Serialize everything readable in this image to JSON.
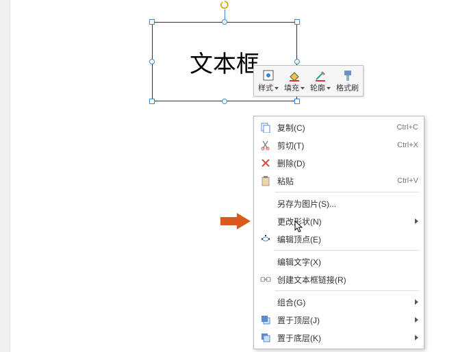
{
  "textbox": {
    "text": "文本框"
  },
  "toolbar": {
    "style": "样式",
    "fill": "填充",
    "outline": "轮廓",
    "format": "格式刷"
  },
  "ctx": {
    "copy": "复制(C)",
    "copy_sc": "Ctrl+C",
    "cut": "剪切(T)",
    "cut_sc": "Ctrl+X",
    "delete": "删除(D)",
    "paste": "粘贴",
    "paste_sc": "Ctrl+V",
    "save_pic": "另存为图片(S)...",
    "change_shape": "更改形状(N)",
    "edit_points": "编辑顶点(E)",
    "edit_text": "编辑文字(X)",
    "create_link": "创建文本框链接(R)",
    "group": "组合(G)",
    "bring_front": "置于顶层(J)",
    "send_back": "置于底层(K)"
  }
}
